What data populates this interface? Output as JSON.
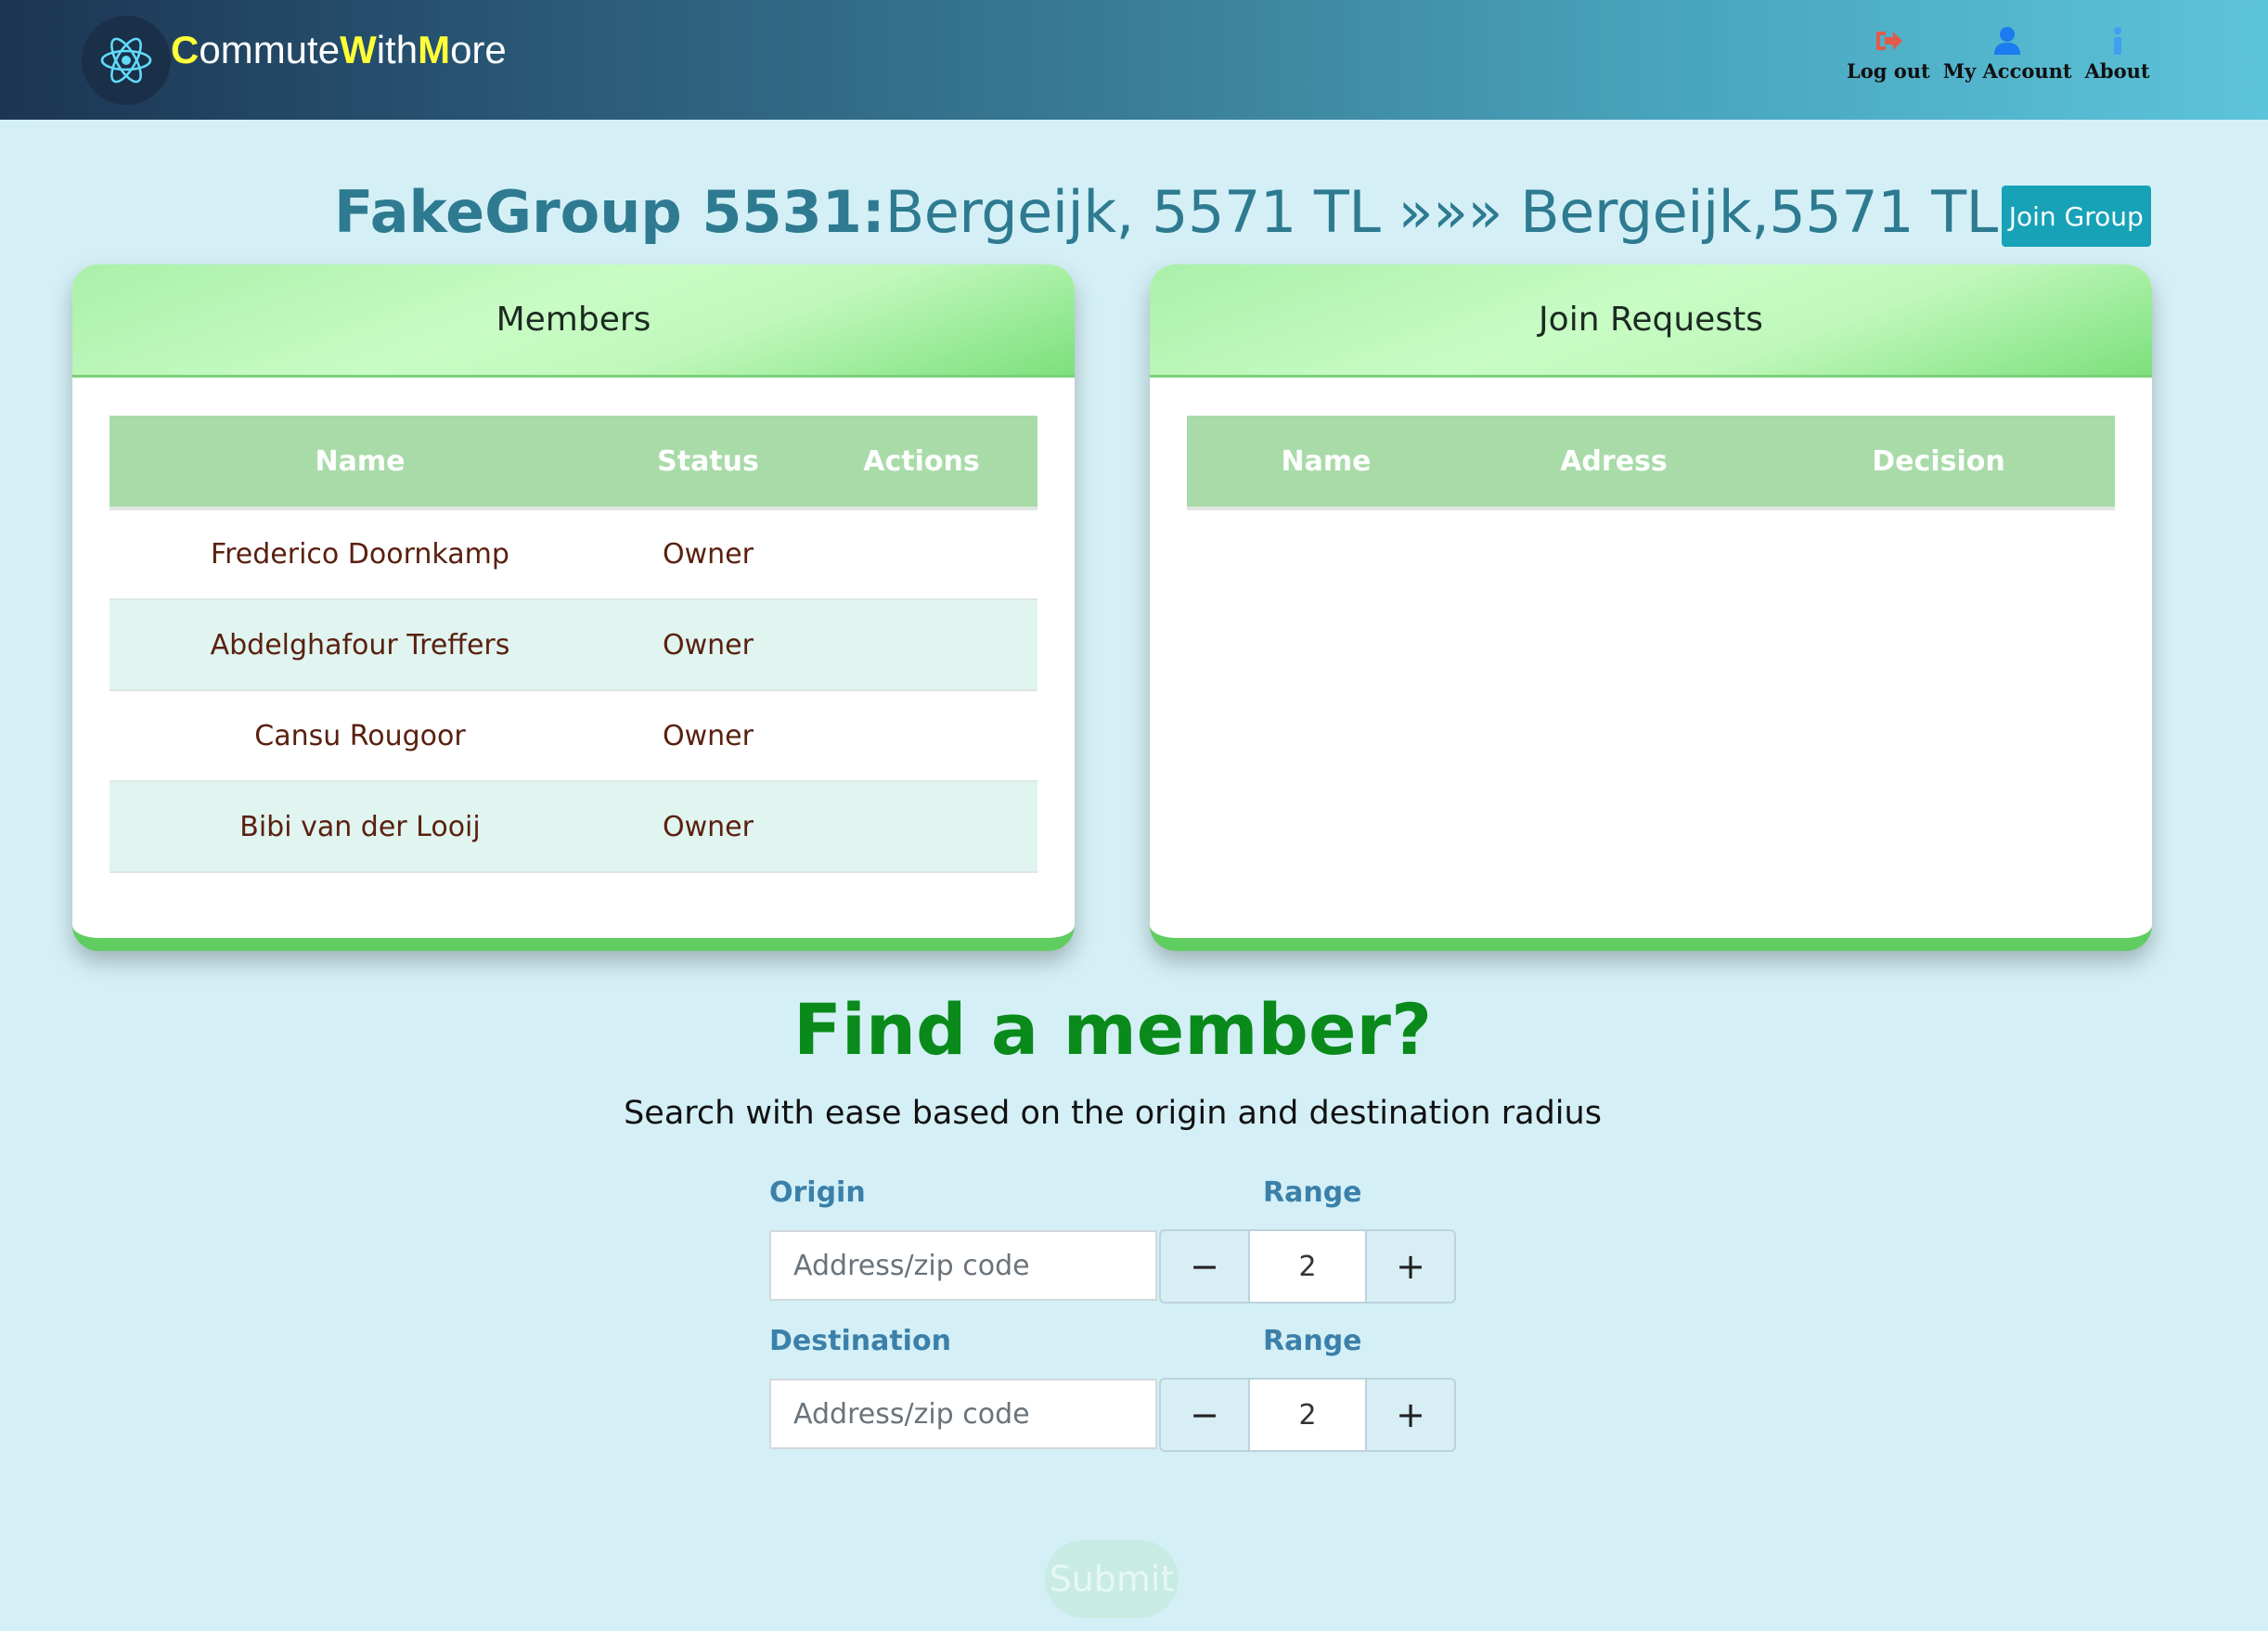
{
  "navbar": {
    "brand": {
      "c1": "C",
      "t1": "ommute",
      "c2": "W",
      "t2": "ith",
      "c3": "M",
      "t3": "ore"
    },
    "links": [
      {
        "label": "Log out",
        "icon": "logout-icon",
        "color": "#e15a4a"
      },
      {
        "label": "My Account",
        "icon": "user-icon",
        "color": "#1a7cf0"
      },
      {
        "label": "About",
        "icon": "info-icon",
        "color": "#3fa0f0"
      }
    ]
  },
  "group": {
    "name": "FakeGroup 5531:",
    "route": "Bergeijk, 5571 TL »»» Bergeijk,5571 TL",
    "join_label": "Join Group"
  },
  "members": {
    "title": "Members",
    "columns": [
      "Name",
      "Status",
      "Actions"
    ],
    "rows": [
      {
        "name": "Frederico Doornkamp",
        "status": "Owner"
      },
      {
        "name": "Abdelghafour Treffers",
        "status": "Owner"
      },
      {
        "name": "Cansu Rougoor",
        "status": "Owner"
      },
      {
        "name": "Bibi van der Looij",
        "status": "Owner"
      }
    ]
  },
  "requests": {
    "title": "Join Requests",
    "columns": [
      "Name",
      "Adress",
      "Decision"
    ]
  },
  "find": {
    "title": "Find a member?",
    "subtitle": "Search with ease based on the origin and destination radius",
    "origin_label": "Origin",
    "destination_label": "Destination",
    "range_label": "Range",
    "placeholder": "Address/zip code",
    "origin_range": "2",
    "destination_range": "2",
    "minus": "−",
    "plus": "+",
    "submit_label": "Submit"
  }
}
